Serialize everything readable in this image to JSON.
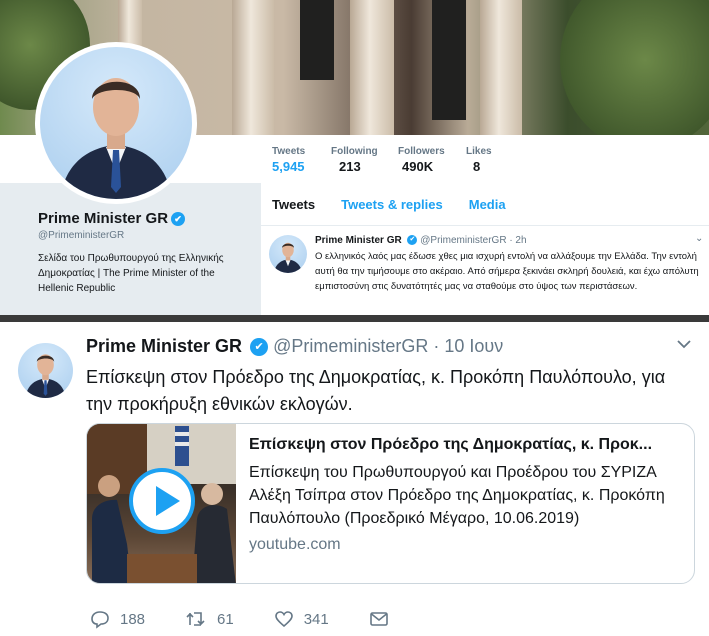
{
  "profile": {
    "name": "Prime Minister GR",
    "verified_icon": "✔",
    "handle": "@PrimeministerGR",
    "bio": "Σελίδα του Πρωθυπουργού της Ελληνικής Δημοκρατίας | The Prime Minister of the Hellenic Republic",
    "stats": [
      {
        "label": "Tweets",
        "value": "5,945"
      },
      {
        "label": "Following",
        "value": "213"
      },
      {
        "label": "Followers",
        "value": "490K"
      },
      {
        "label": "Likes",
        "value": "8"
      }
    ]
  },
  "timeline": {
    "tabs": [
      "Tweets",
      "Tweets & replies",
      "Media"
    ],
    "tweet": {
      "name": "Prime Minister GR",
      "handle": "@PrimeministerGR",
      "time": "· 2h",
      "text": "Ο ελληνικός λαός μας έδωσε χθες μια ισχυρή εντολή να αλλάξουμε την Ελλάδα. Την εντολή αυτή θα την τιμήσουμε στο ακέραιο. Από σήμερα ξεκινάει σκληρή δουλειά, και έχω απόλυτη εμπιστοσύνη στις δυνατότητές μας να σταθούμε στο ύψος των περιστάσεων."
    }
  },
  "tweet": {
    "name": "Prime Minister GR",
    "handle": "@PrimeministerGR",
    "time": "· 10 Ιουν",
    "text": "Επίσκεψη στον Πρόεδρο της Δημοκρατίας, κ. Προκόπη Παυλόπουλο, για την προκήρυξη εθνικών εκλογών.",
    "card": {
      "title": "Επίσκεψη στον Πρόεδρο της Δημοκρατίας, κ. Προκ...",
      "description": "Επίσκεψη του Πρωθυπουργού και Προέδρου του ΣΥΡΙΖΑ Αλέξη Τσίπρα στον Πρόεδρο της Δημοκρατίας, κ. Προκόπη Παυλόπουλο (Προεδρικό Μέγαρο, 10.06.2019)",
      "domain": "youtube.com"
    },
    "actions": {
      "replies": "188",
      "retweets": "61",
      "likes": "341"
    }
  },
  "colors": {
    "accent": "#1da1f2",
    "muted": "#657786",
    "text": "#14171a"
  },
  "icons": [
    "reply-icon",
    "retweet-icon",
    "like-icon",
    "message-icon",
    "chevron-down-icon",
    "play-icon",
    "verified-icon"
  ]
}
